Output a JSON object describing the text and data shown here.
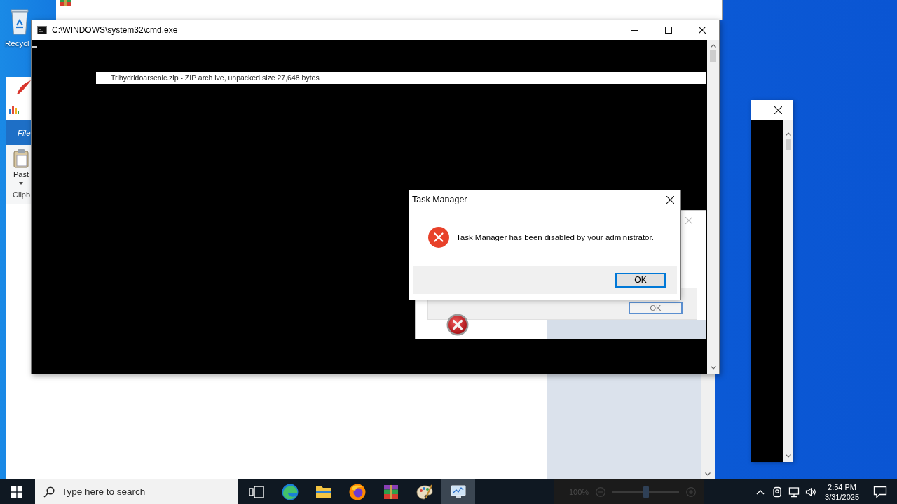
{
  "desktop_icons": [
    {
      "label": "Recycl"
    }
  ],
  "editor_window": {
    "ribbon_tab": "File",
    "paste_button": "Past",
    "ribbon_group": "Clipb",
    "zoom": {
      "reading": "100%",
      "level": 0.5
    }
  },
  "cmd_window": {
    "title": "C:\\WINDOWS\\system32\\cmd.exe",
    "lines": [
      {
        "text": "Trihydridoarsenic.zip - ZIP arch ive, unpacked size 27,648 bytes",
        "selected": true
      }
    ]
  },
  "background_dialog": {
    "button": "OK"
  },
  "dialog": {
    "title": "Task Manager",
    "message": "Task Manager has been disabled by your administrator.",
    "button": "OK"
  },
  "taskbar": {
    "search": {
      "placeholder": "Type here to search"
    },
    "apps": [
      {
        "kind": "task-view",
        "selected": false
      },
      {
        "kind": "swirl",
        "selected": false
      },
      {
        "kind": "folder",
        "selected": false
      },
      {
        "kind": "globe",
        "selected": false
      },
      {
        "kind": "books",
        "selected": false
      },
      {
        "kind": "palette",
        "selected": false
      },
      {
        "kind": "monitor",
        "selected": true
      }
    ],
    "clock": {
      "time": "2:54 PM",
      "date": "3/31/2025"
    }
  }
}
